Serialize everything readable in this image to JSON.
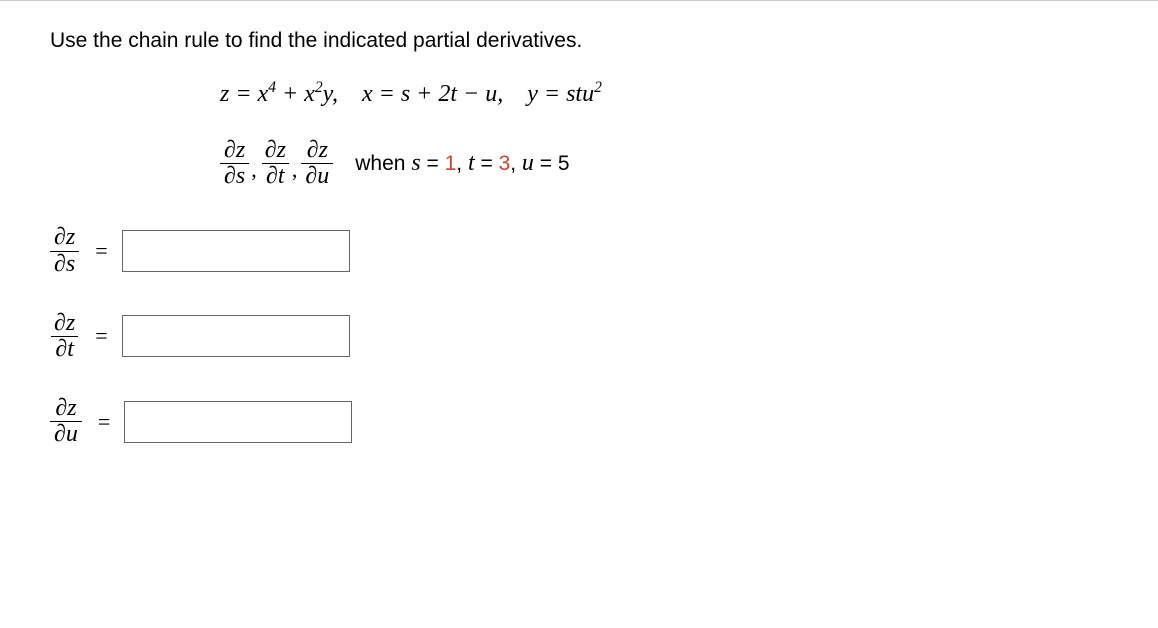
{
  "problem": {
    "prompt": "Use the chain rule to find the indicated partial derivatives.",
    "equation_parts": {
      "z_eq": "z = x",
      "z_exp1": "4",
      "plus": " + x",
      "z_exp2": "2",
      "y_term": "y,",
      "x_def": "   x = s + 2t − u,",
      "y_def_pre": "   y = stu",
      "y_def_exp": "2"
    },
    "derivatives": {
      "d1_num": "∂z",
      "d1_den": "∂s",
      "d2_num": "∂z",
      "d2_den": "∂t",
      "d3_num": "∂z",
      "d3_den": "∂u"
    },
    "when": {
      "word": "when  ",
      "s_label": "s",
      "eq1": " = ",
      "s_val": "1",
      "sep1": ", ",
      "t_label": "t",
      "eq2": " = ",
      "t_val": "3",
      "sep2": ", ",
      "u_label": "u",
      "eq3": " = ",
      "u_val": "5"
    }
  },
  "answers": {
    "row1": {
      "num": "∂z",
      "den": "∂s",
      "eq": "=",
      "value": ""
    },
    "row2": {
      "num": "∂z",
      "den": "∂t",
      "eq": "=",
      "value": ""
    },
    "row3": {
      "num": "∂z",
      "den": "∂u",
      "eq": "=",
      "value": ""
    }
  }
}
